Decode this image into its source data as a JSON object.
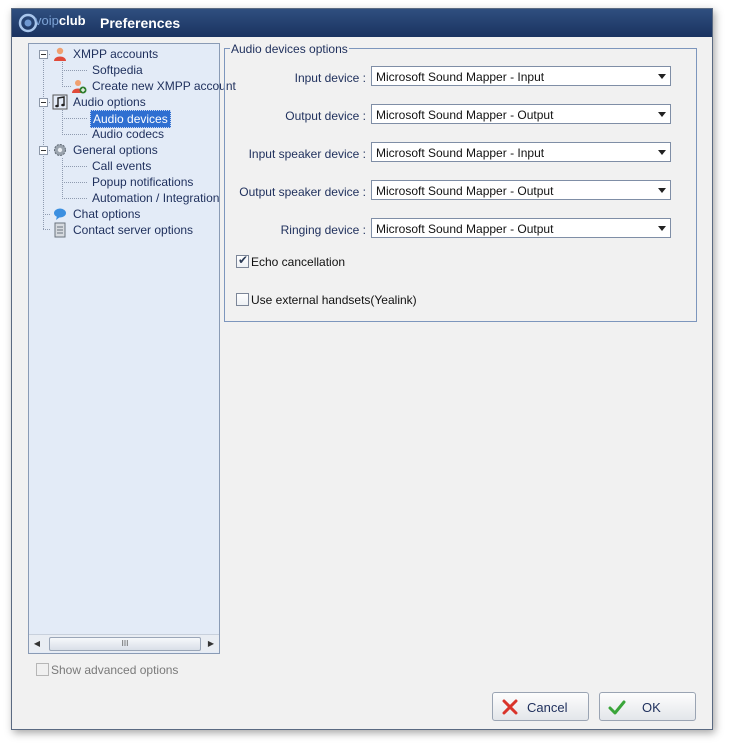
{
  "window": {
    "logo": {
      "text_part1": "voip",
      "text_part2": "club"
    },
    "title": "Preferences"
  },
  "tree": {
    "items": [
      {
        "label": "XMPP accounts",
        "level": 0,
        "icon": "user-icon",
        "expanded": true
      },
      {
        "label": "Softpedia",
        "level": 1,
        "icon": ""
      },
      {
        "label": "Create new XMPP account",
        "level": 1,
        "icon": "add-user-icon"
      },
      {
        "label": "Audio options",
        "level": 0,
        "icon": "music-note-icon",
        "expanded": true
      },
      {
        "label": "Audio devices",
        "level": 1,
        "icon": "",
        "selected": true
      },
      {
        "label": "Audio codecs",
        "level": 1,
        "icon": ""
      },
      {
        "label": "General options",
        "level": 0,
        "icon": "gear-icon",
        "expanded": true
      },
      {
        "label": "Call events",
        "level": 1,
        "icon": ""
      },
      {
        "label": "Popup notifications",
        "level": 1,
        "icon": ""
      },
      {
        "label": "Automation / Integration",
        "level": 1,
        "icon": ""
      },
      {
        "label": "Chat options",
        "level": 0,
        "icon": "chat-bubble-icon"
      },
      {
        "label": "Contact server options",
        "level": 0,
        "icon": "server-icon"
      }
    ],
    "scroll_thumb_label": "III"
  },
  "show_advanced": {
    "label": "Show advanced options",
    "checked": false,
    "enabled": false
  },
  "audio_group": {
    "title": "Audio devices options",
    "devices": [
      {
        "label": "Input device :",
        "value": "Microsoft Sound Mapper - Input"
      },
      {
        "label": "Output device :",
        "value": "Microsoft Sound Mapper - Output"
      },
      {
        "label": "Input speaker device :",
        "value": "Microsoft Sound Mapper - Input"
      },
      {
        "label": "Output speaker device :",
        "value": "Microsoft Sound Mapper - Output"
      },
      {
        "label": "Ringing device :",
        "value": "Microsoft Sound Mapper - Output"
      }
    ],
    "echo_cancellation": {
      "label": "Echo cancellation",
      "checked": true
    },
    "external_handsets": {
      "label": "Use external handsets(Yealink)",
      "checked": false
    }
  },
  "buttons": {
    "cancel": "Cancel",
    "ok": "OK"
  },
  "colors": {
    "titlebar": "#1a3360",
    "tree_bg": "#e3ebf7",
    "selected": "#2f6fd1",
    "ok_check": "#3aa53a",
    "cancel_x": "#d9342b"
  }
}
